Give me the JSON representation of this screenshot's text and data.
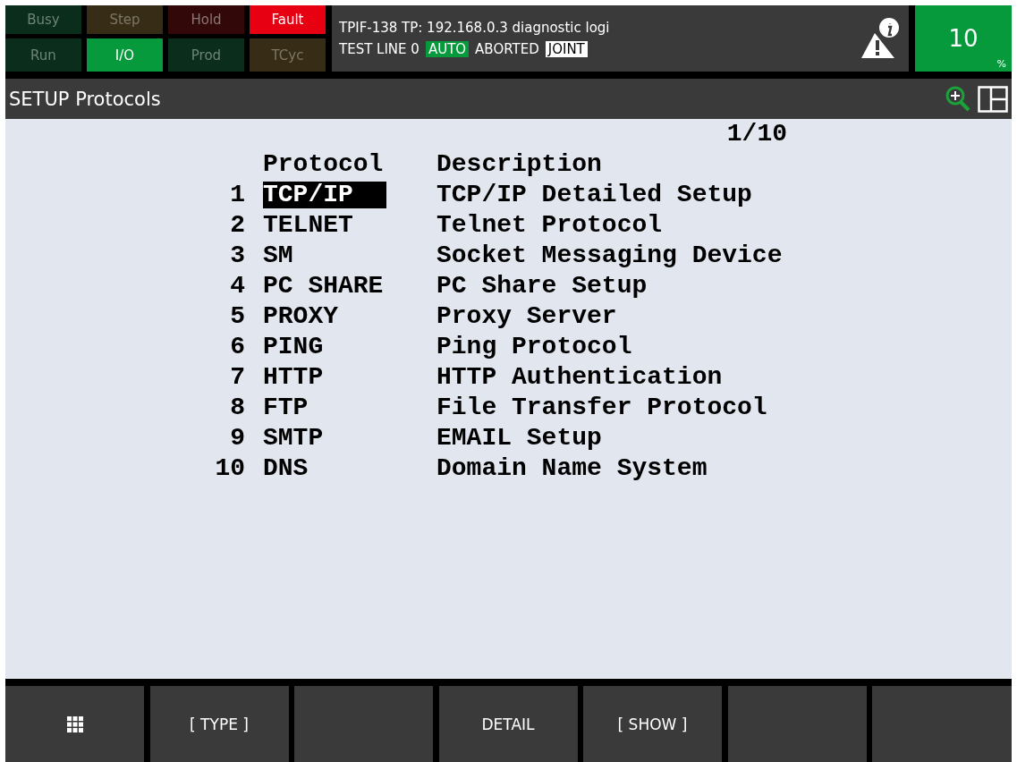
{
  "status_lamps": [
    {
      "label": "Busy",
      "kind": "green",
      "on": false
    },
    {
      "label": "Step",
      "kind": "amber",
      "on": false
    },
    {
      "label": "Hold",
      "kind": "red",
      "on": false
    },
    {
      "label": "Fault",
      "kind": "red",
      "on": true
    },
    {
      "label": "Run",
      "kind": "green",
      "on": false
    },
    {
      "label": "I/O",
      "kind": "green",
      "on": true
    },
    {
      "label": "Prod",
      "kind": "green",
      "on": false
    },
    {
      "label": "TCyc",
      "kind": "amber",
      "on": false
    }
  ],
  "status_panel": {
    "message": "TPIF-138 TP: 192.168.0.3 diagnostic logi",
    "line": [
      {
        "text": "TEST LINE 0",
        "kind": "plain"
      },
      {
        "text": "AUTO",
        "kind": "green"
      },
      {
        "text": "ABORTED",
        "kind": "plain"
      },
      {
        "text": "JOINT",
        "kind": "white"
      }
    ]
  },
  "override": {
    "value": "10",
    "unit": "%"
  },
  "header": {
    "title": "SETUP Protocols"
  },
  "page_indicator": "1/10",
  "table": {
    "columns": [
      "Protocol",
      "Description"
    ],
    "rows": [
      {
        "number": "1",
        "protocol": "TCP/IP",
        "description": "TCP/IP Detailed Setup",
        "selected": true
      },
      {
        "number": "2",
        "protocol": "TELNET",
        "description": "Telnet Protocol",
        "selected": false
      },
      {
        "number": "3",
        "protocol": "SM",
        "description": "Socket Messaging Device",
        "selected": false
      },
      {
        "number": "4",
        "protocol": "PC SHARE",
        "description": "PC Share Setup",
        "selected": false
      },
      {
        "number": "5",
        "protocol": "PROXY",
        "description": "Proxy Server",
        "selected": false
      },
      {
        "number": "6",
        "protocol": "PING",
        "description": "Ping Protocol",
        "selected": false
      },
      {
        "number": "7",
        "protocol": "HTTP",
        "description": "HTTP Authentication",
        "selected": false
      },
      {
        "number": "8",
        "protocol": "FTP",
        "description": "File Transfer Protocol",
        "selected": false
      },
      {
        "number": "9",
        "protocol": "SMTP",
        "description": "EMAIL Setup",
        "selected": false
      },
      {
        "number": "10",
        "protocol": "DNS",
        "description": "Domain Name System",
        "selected": false
      }
    ]
  },
  "function_keys": [
    {
      "kind": "menu"
    },
    {
      "kind": "label",
      "label": "[ TYPE ]"
    },
    {
      "kind": "blank"
    },
    {
      "kind": "label",
      "label": "DETAIL"
    },
    {
      "kind": "label",
      "label": "[ SHOW ]"
    },
    {
      "kind": "blank"
    },
    {
      "kind": "blank"
    }
  ]
}
